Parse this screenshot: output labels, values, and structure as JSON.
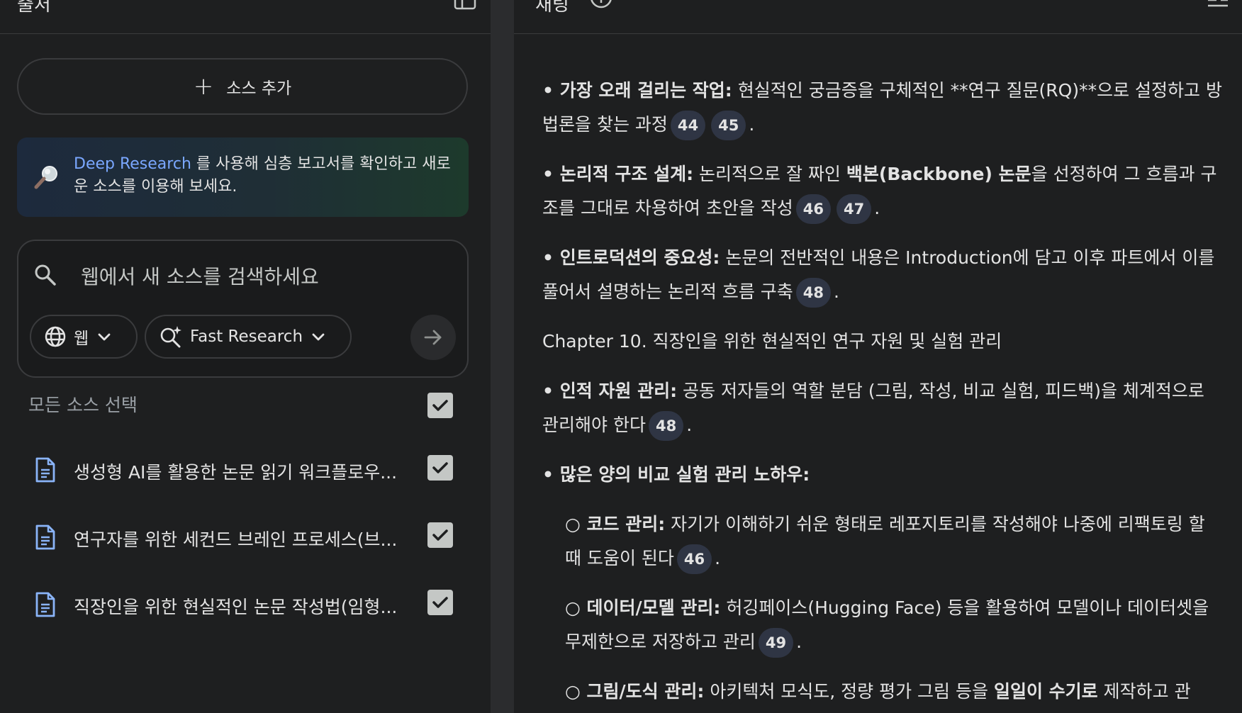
{
  "left_panel": {
    "title": "출처",
    "add_source_label": "소스 추가",
    "deep_research": {
      "link_text": "Deep Research",
      "text": " 를 사용해 심층 보고서를 확인하고 새로운 소스를 이용해 보세요."
    },
    "search": {
      "placeholder": "웹에서 새 소스를 검색하세요",
      "scope_label": "웹",
      "mode_label": "Fast Research"
    },
    "select_all_label": "모든 소스 선택",
    "sources": [
      {
        "name": "생성형 AI를 활용한 논문 읽기 워크플로우...",
        "checked": true,
        "icon": "document-icon"
      },
      {
        "name": "연구자를 위한 세컨드 브레인 프로세스(브...",
        "checked": true,
        "icon": "document-icon"
      },
      {
        "name": "직장인을 위한 현실적인 논문 작성법(임형...",
        "checked": true,
        "icon": "document-icon"
      }
    ]
  },
  "right_panel": {
    "title": "채팅",
    "items": [
      {
        "bold": "가장 오래 걸리는 작업:",
        "text": " 현실적인 궁금증을 구체적인 **연구 질문(RQ)**으로 설정하고 방법론을 찾는 과정",
        "cites": [
          "44",
          "45"
        ]
      },
      {
        "bold": "논리적 구조 설계:",
        "text": " 논리적으로 잘 짜인 ",
        "bold2": "백본(Backbone) 논문",
        "text2": "을 선정하여 그 흐름과 구조를 그대로 차용하여 초안을 작성",
        "cites": [
          "46",
          "47"
        ]
      },
      {
        "bold": "인트로덕션의 중요성:",
        "text": " 논문의 전반적인 내용은 Introduction에 담고 이후 파트에서 이를 풀어서 설명하는 논리적 흐름 구축",
        "cites": [
          "48"
        ]
      },
      {
        "heading": "Chapter 10. 직장인을 위한 현실적인 연구 자원 및 실험 관리"
      },
      {
        "bold": "인적 자원 관리:",
        "text": " 공동 저자들의 역할 분담 (그림, 작성, 비교 실험, 피드백)을 체계적으로 관리해야 한다",
        "cites": [
          "48"
        ]
      },
      {
        "bold": "많은 양의 비교 실험 관리 노하우:"
      },
      {
        "sub": true,
        "bold": "코드 관리:",
        "text": " 자기가 이해하기 쉬운 형태로 레포지토리를 작성해야 나중에 리팩토링 할 때 도움이 된다",
        "cites": [
          "46"
        ]
      },
      {
        "sub": true,
        "bold": "데이터/모델 관리:",
        "text": " 허깅페이스(Hugging Face) 등을 활용하여 모델이나 데이터셋을 무제한으로 저장하고 관리",
        "cites": [
          "49"
        ]
      },
      {
        "sub": true,
        "bold": "그림/도식 관리:",
        "text": " 아키텍처 모식도, 정량 평가 그림 등을 ",
        "bold2": "일일이 수기로",
        "text2": " 제작하고 관"
      }
    ]
  },
  "colors": {
    "accent_link": "#7aa7ff",
    "citation_bg": "#2f3544",
    "doc_icon": "#8ab4f8"
  }
}
